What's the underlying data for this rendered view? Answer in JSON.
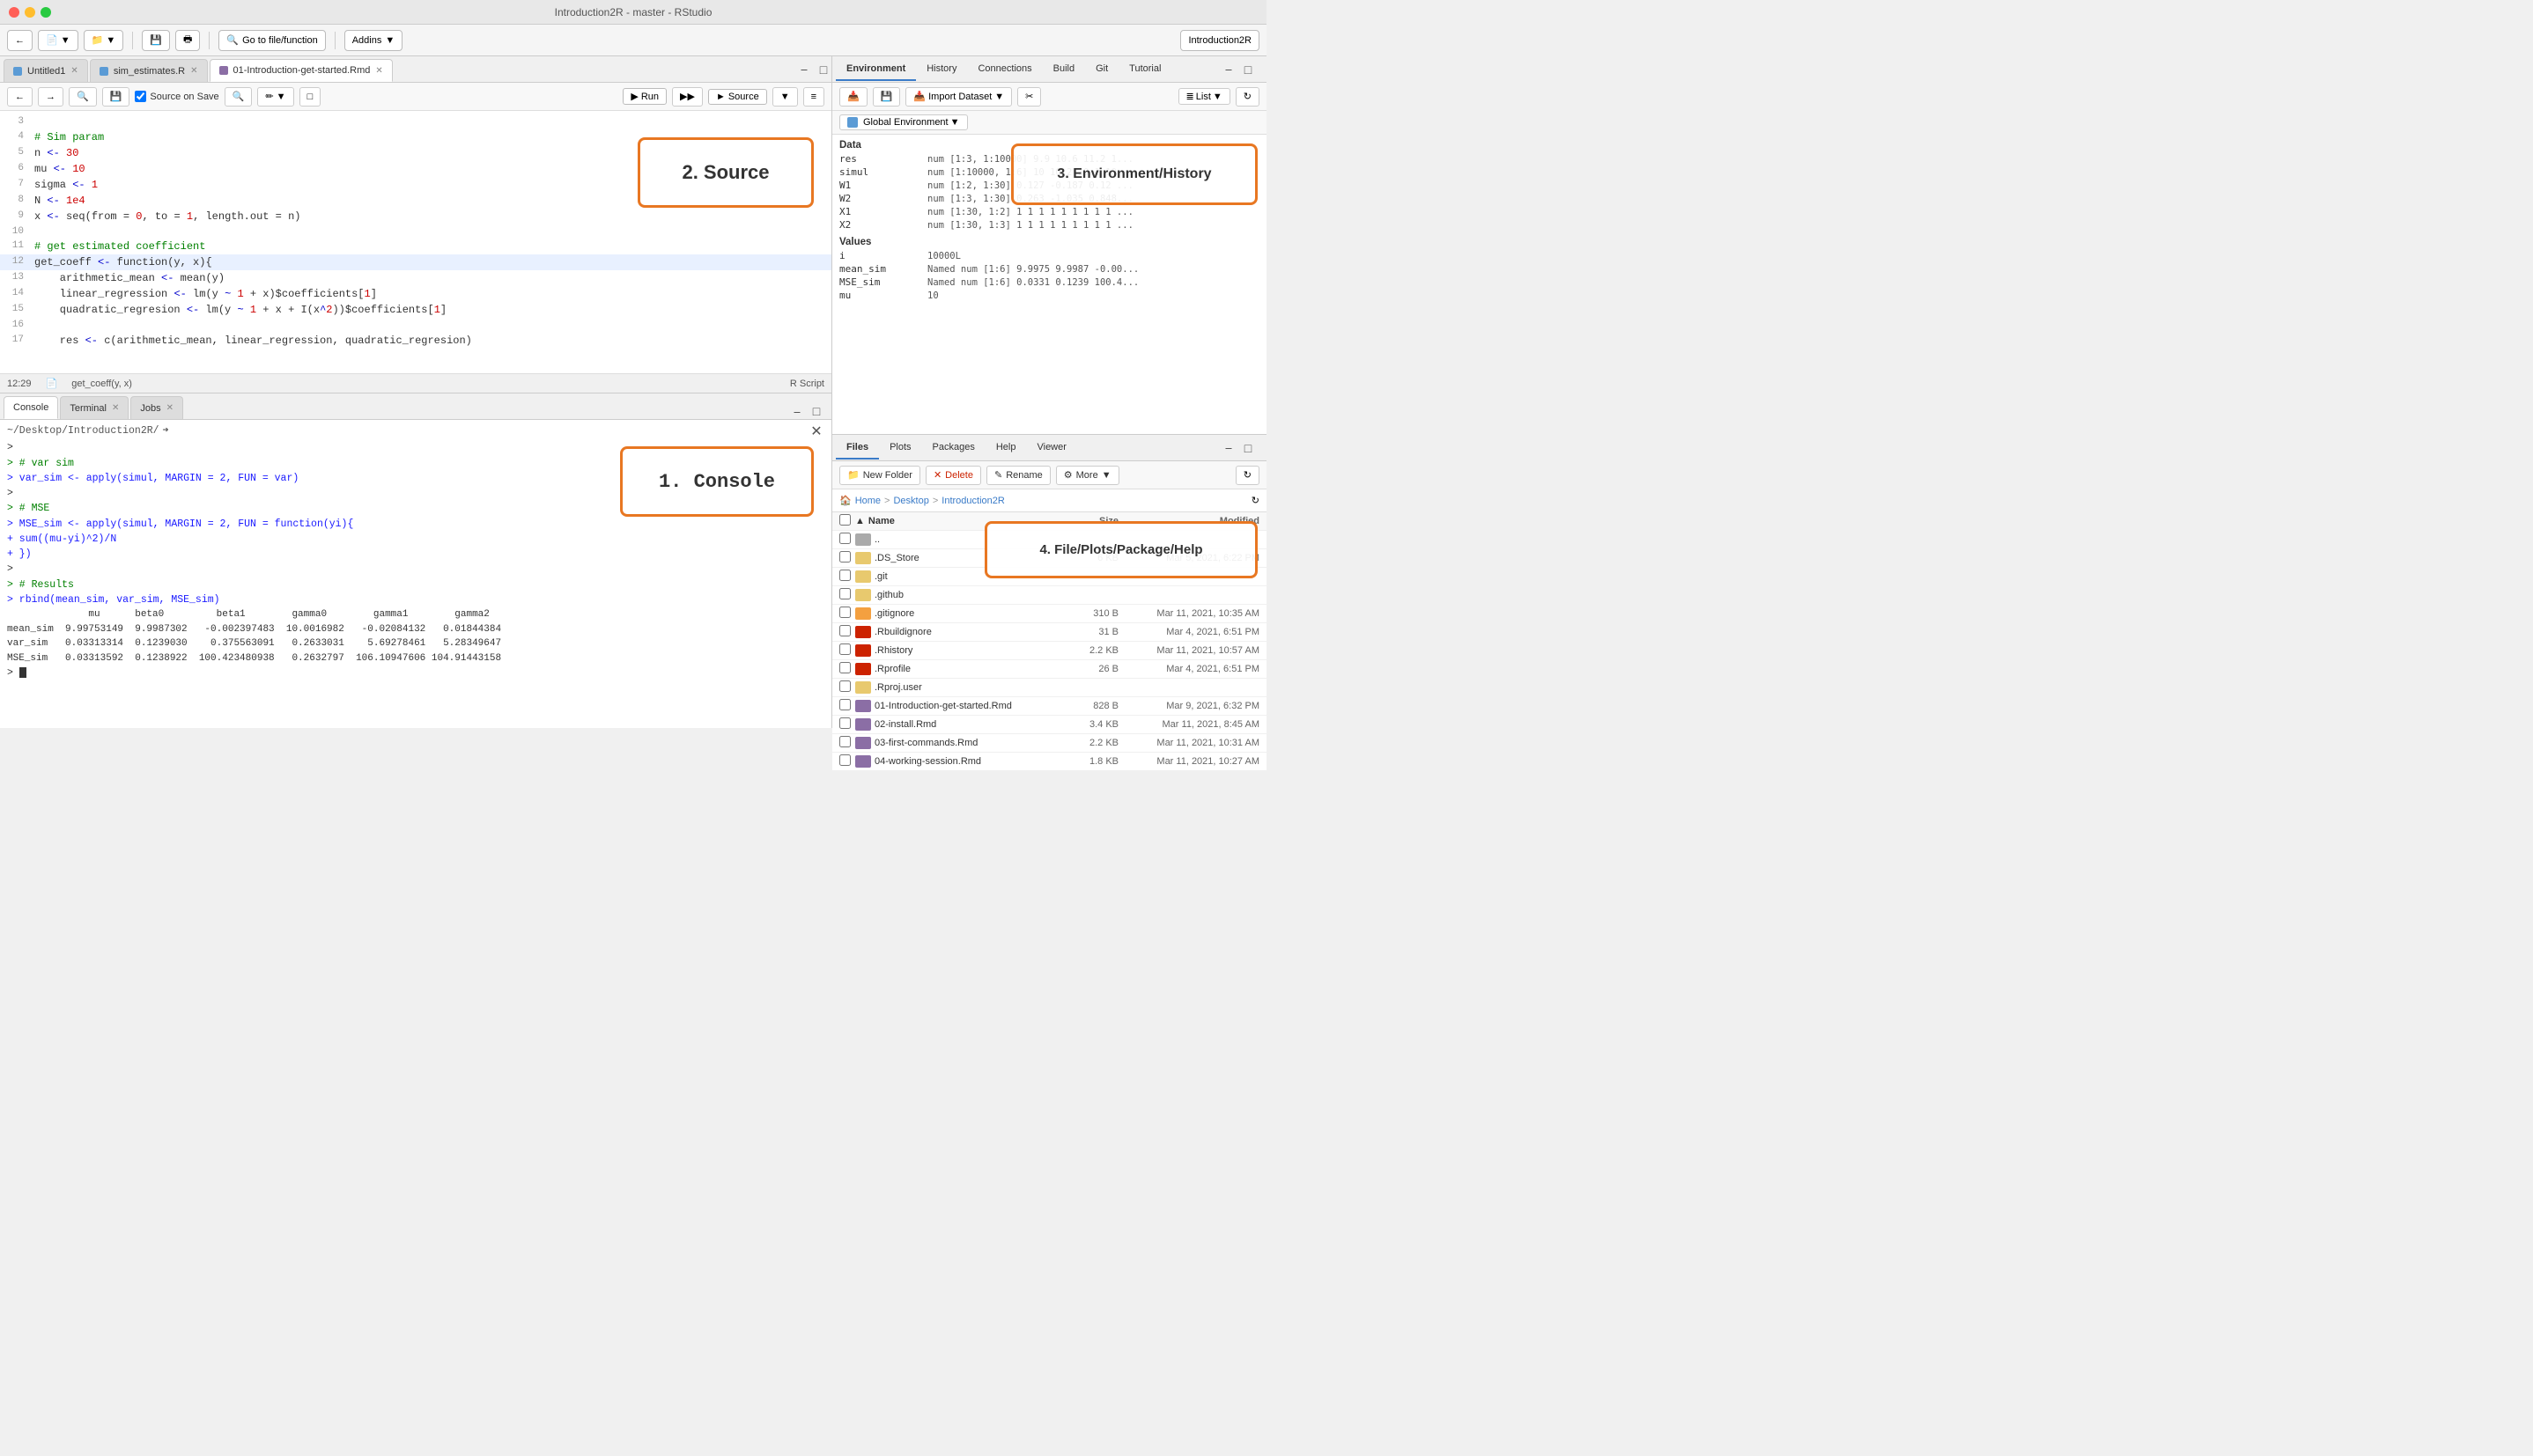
{
  "window": {
    "title": "Introduction2R - master - RStudio"
  },
  "titlebar": {
    "title": "Introduction2R - master – RStudio",
    "app_name": "Introduction2R"
  },
  "toolbar": {
    "goto_placeholder": "Go to file/function",
    "addins_label": "Addins",
    "workspace_label": "Introduction2R"
  },
  "editor": {
    "tabs": [
      {
        "label": "Untitled1",
        "icon": "r",
        "active": false,
        "closeable": true
      },
      {
        "label": "sim_estimates.R",
        "icon": "r",
        "active": false,
        "closeable": true
      },
      {
        "label": "01-Introduction-get-started.Rmd",
        "icon": "rmd",
        "active": true,
        "closeable": true
      }
    ],
    "source_on_save": true,
    "run_label": "Run",
    "source_label": "Source",
    "annotation": "2. Source",
    "status": {
      "position": "12:29",
      "function": "get_coeff(y, x)",
      "script_type": "R Script"
    },
    "lines": [
      {
        "num": "3",
        "content": "",
        "tokens": []
      },
      {
        "num": "4",
        "content": "# Sim param",
        "tokens": [
          {
            "type": "comment",
            "text": "# Sim param"
          }
        ]
      },
      {
        "num": "5",
        "content": "n <- 30",
        "tokens": [
          {
            "type": "plain",
            "text": "n "
          },
          {
            "type": "keyword",
            "text": "<-"
          },
          {
            "type": "plain",
            "text": " "
          },
          {
            "type": "number",
            "text": "30"
          }
        ]
      },
      {
        "num": "6",
        "content": "mu <- 10",
        "tokens": [
          {
            "type": "plain",
            "text": "mu "
          },
          {
            "type": "keyword",
            "text": "<-"
          },
          {
            "type": "plain",
            "text": " "
          },
          {
            "type": "number",
            "text": "10"
          }
        ]
      },
      {
        "num": "7",
        "content": "sigma <- 1",
        "tokens": [
          {
            "type": "plain",
            "text": "sigma "
          },
          {
            "type": "keyword",
            "text": "<-"
          },
          {
            "type": "plain",
            "text": " "
          },
          {
            "type": "number",
            "text": "1"
          }
        ]
      },
      {
        "num": "8",
        "content": "N <- 1e4",
        "tokens": [
          {
            "type": "plain",
            "text": "N "
          },
          {
            "type": "keyword",
            "text": "<-"
          },
          {
            "type": "plain",
            "text": " "
          },
          {
            "type": "number",
            "text": "1e4"
          }
        ]
      },
      {
        "num": "9",
        "content": "x <- seq(from = 0, to = 1, length.out = n)",
        "tokens": []
      },
      {
        "num": "10",
        "content": "",
        "tokens": []
      },
      {
        "num": "11",
        "content": "# get estimated coefficient",
        "tokens": [
          {
            "type": "comment",
            "text": "# get estimated coefficient"
          }
        ]
      },
      {
        "num": "12",
        "content": "get_coeff <- function(y, x){",
        "tokens": []
      },
      {
        "num": "13",
        "content": "    arithmetic_mean <- mean(y)",
        "tokens": []
      },
      {
        "num": "14",
        "content": "    linear_regression <- lm(y ~ 1 + x)$coefficients[1]",
        "tokens": []
      },
      {
        "num": "15",
        "content": "    quadratic_regresion <- lm(y ~ 1 + x + I(x^2))$coefficients[1]",
        "tokens": []
      },
      {
        "num": "16",
        "content": "",
        "tokens": []
      },
      {
        "num": "17",
        "content": "    res <- c(arithmetic_mean, linear_regression, quadratic_regresion)",
        "tokens": []
      }
    ]
  },
  "console": {
    "tabs": [
      {
        "label": "Console",
        "active": true
      },
      {
        "label": "Terminal",
        "active": false
      },
      {
        "label": "Jobs",
        "active": false
      }
    ],
    "path": "~/Desktop/Introduction2R/",
    "annotation": "1. Console",
    "lines": [
      {
        "type": "prompt",
        "text": ">"
      },
      {
        "type": "comment",
        "text": "> # var sim"
      },
      {
        "type": "cmd",
        "text": "> var_sim <- apply(simul, MARGIN = 2, FUN = var)"
      },
      {
        "type": "prompt",
        "text": ">"
      },
      {
        "type": "comment",
        "text": "> # MSE"
      },
      {
        "type": "cmd",
        "text": "> MSE_sim <- apply(simul, MARGIN = 2, FUN = function(yi){"
      },
      {
        "type": "cmd",
        "text": "+     sum((mu-yi)^2)/N"
      },
      {
        "type": "cmd",
        "text": "+ })"
      },
      {
        "type": "prompt",
        "text": ">"
      },
      {
        "type": "comment",
        "text": "> # Results"
      },
      {
        "type": "cmd",
        "text": "> rbind(mean_sim, var_sim, MSE_sim)"
      }
    ],
    "output": {
      "header": "              mu      beta0         beta1        gamma0        gamma1        gamma2",
      "rows": [
        "mean_sim  9.99753149  9.9987302   -0.002397483  10.0016982   -0.02084132   0.01844384",
        "var_sim   0.03313314  0.1239030    0.375563091   0.2633031    5.69278461   5.28349647",
        "MSE_sim   0.03313592  0.1238922  100.423480938   0.2632797  106.10947606 104.91443158"
      ]
    }
  },
  "environment": {
    "tabs": [
      {
        "label": "Environment",
        "active": true
      },
      {
        "label": "History",
        "active": false
      },
      {
        "label": "Connections",
        "active": false
      },
      {
        "label": "Build",
        "active": false
      },
      {
        "label": "Git",
        "active": false
      },
      {
        "label": "Tutorial",
        "active": false
      }
    ],
    "annotation": "3. Environment/History",
    "global_env": "Global Environment",
    "import_dataset": "Import Dataset",
    "list_view": "List",
    "sections": {
      "data": {
        "label": "Data",
        "items": [
          {
            "name": "res",
            "value": "num [1:3, 1:10000] 9.9 10.6 11.2 1..."
          },
          {
            "name": "simul",
            "value": "num [1:10000, 1:6] 10 10.2 10.1 10..."
          },
          {
            "name": "W1",
            "value": "num [1:2, 1:30] 0.127 -0.187 0.12 ..."
          },
          {
            "name": "W2",
            "value": "num [1:3, 1:30] 0.263 -1.035 0.848..."
          },
          {
            "name": "X1",
            "value": "num [1:30, 1:2] 1 1 1 1 1 1 1 1 1 ..."
          },
          {
            "name": "X2",
            "value": "num [1:30, 1:3] 1 1 1 1 1 1 1 1 1 ..."
          }
        ]
      },
      "values": {
        "label": "Values",
        "items": [
          {
            "name": "i",
            "value": "10000L"
          },
          {
            "name": "mean_sim",
            "value": "Named num [1:6] 9.9975 9.9987 -0.00..."
          },
          {
            "name": "MSE_sim",
            "value": "Named num [1:6] 0.0331 0.1239 100.4..."
          },
          {
            "name": "mu",
            "value": "10"
          }
        ]
      }
    }
  },
  "files": {
    "tabs": [
      {
        "label": "Files",
        "active": true
      },
      {
        "label": "Plots",
        "active": false
      },
      {
        "label": "Packages",
        "active": false
      },
      {
        "label": "Help",
        "active": false
      },
      {
        "label": "Viewer",
        "active": false
      }
    ],
    "annotation": "4. File/Plots/Package/Help",
    "toolbar": {
      "new_folder": "New Folder",
      "delete": "Delete",
      "rename": "Rename",
      "more": "More"
    },
    "path": [
      "Home",
      "Desktop",
      "Introduction2R"
    ],
    "columns": [
      "Name",
      "Size",
      "Modified"
    ],
    "items": [
      {
        "name": "..",
        "type": "up",
        "size": "",
        "date": ""
      },
      {
        "name": ".DS_Store",
        "type": "folder",
        "size": "6 KB",
        "date": "Mar 5, 2021, 6:22 PM"
      },
      {
        "name": ".git",
        "type": "folder",
        "size": "",
        "date": ""
      },
      {
        "name": ".github",
        "type": "folder",
        "size": "",
        "date": ""
      },
      {
        "name": ".gitignore",
        "type": "git",
        "size": "310 B",
        "date": "Mar 11, 2021, 10:35 AM"
      },
      {
        "name": ".Rbuildignore",
        "type": "r",
        "size": "31 B",
        "date": "Mar 4, 2021, 6:51 PM"
      },
      {
        "name": ".Rhistory",
        "type": "r",
        "size": "2.2 KB",
        "date": "Mar 11, 2021, 10:57 AM"
      },
      {
        "name": ".Rprofile",
        "type": "r",
        "size": "26 B",
        "date": "Mar 4, 2021, 6:51 PM"
      },
      {
        "name": ".Rproj.user",
        "type": "folder",
        "size": "",
        "date": ""
      },
      {
        "name": "01-Introduction-get-started.Rmd",
        "type": "rmd",
        "size": "828 B",
        "date": "Mar 9, 2021, 6:32 PM"
      },
      {
        "name": "02-install.Rmd",
        "type": "rmd",
        "size": "3.4 KB",
        "date": "Mar 11, 2021, 8:45 AM"
      },
      {
        "name": "03-first-commands.Rmd",
        "type": "rmd",
        "size": "2.2 KB",
        "date": "Mar 11, 2021, 10:31 AM"
      },
      {
        "name": "04-working-session.Rmd",
        "type": "rmd",
        "size": "1.8 KB",
        "date": "Mar 11, 2021, 10:27 AM"
      }
    ]
  }
}
